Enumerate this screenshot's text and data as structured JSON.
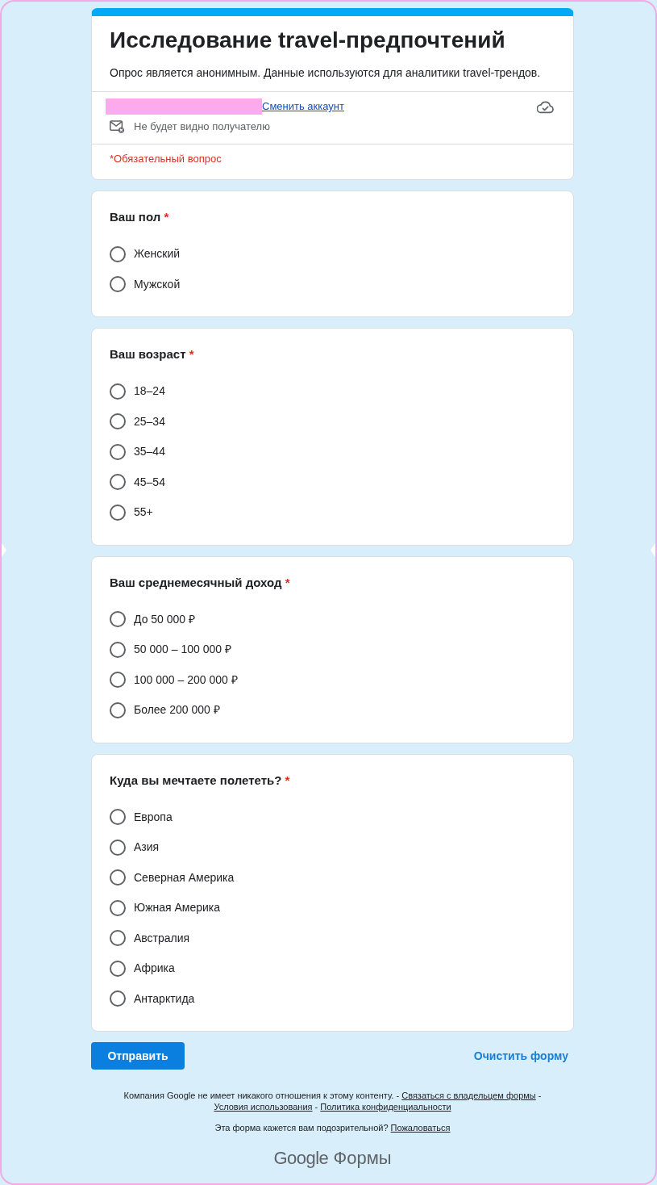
{
  "header": {
    "title": "Исследование travel-предпочтений",
    "description": "Опрос является анонимным. Данные используются для аналитики travel-трендов.",
    "switch_account": "Сменить аккаунт",
    "privacy_note": "Не будет видно получателю",
    "required_note": "*Обязательный вопрос"
  },
  "questions": [
    {
      "title": "Ваш пол",
      "required_mark": "*",
      "options": [
        {
          "label": "Женский",
          "selected": false
        },
        {
          "label": "Мужской",
          "selected": false
        }
      ]
    },
    {
      "title": "Ваш возраст",
      "required_mark": "*",
      "options": [
        {
          "label": "18–24",
          "selected": false
        },
        {
          "label": "25–34",
          "selected": false
        },
        {
          "label": "35–44",
          "selected": false
        },
        {
          "label": "45–54",
          "selected": false
        },
        {
          "label": "55+",
          "selected": false
        }
      ]
    },
    {
      "title": "Ваш среднемесячный доход",
      "required_mark": "*",
      "options": [
        {
          "label": "До 50 000 ₽",
          "selected": false
        },
        {
          "label": "50 000 – 100 000 ₽",
          "selected": false
        },
        {
          "label": "100 000 – 200 000 ₽",
          "selected": false
        },
        {
          "label": "Более 200 000 ₽",
          "selected": false
        }
      ]
    },
    {
      "title": "Куда вы мечтаете полететь?",
      "required_mark": "*",
      "options": [
        {
          "label": "Европа",
          "selected": false
        },
        {
          "label": "Азия",
          "selected": false
        },
        {
          "label": "Северная Америка",
          "selected": false
        },
        {
          "label": "Южная Америка",
          "selected": false
        },
        {
          "label": "Австралия",
          "selected": false
        },
        {
          "label": "Африка",
          "selected": false
        },
        {
          "label": "Антарктида",
          "selected": false
        }
      ]
    }
  ],
  "actions": {
    "submit": "Отправить",
    "clear": "Очистить форму"
  },
  "footer": {
    "notice": [
      {
        "kind": "text",
        "text": "Компания Google не имеет никакого отношения к этому контенту. -"
      },
      {
        "kind": "link",
        "text": "Связаться с владельцем формы"
      },
      {
        "kind": "text",
        "text": "-"
      },
      {
        "kind": "link",
        "text": "Условия использования"
      },
      {
        "kind": "text",
        "text": "-"
      },
      {
        "kind": "link",
        "text": "Политика конфиденциальности"
      }
    ],
    "report": [
      {
        "kind": "text",
        "text": "Эта форма кажется вам подозрительной?"
      },
      {
        "kind": "link",
        "text": "Пожаловаться"
      }
    ],
    "logo": {
      "brand": "Google",
      "product": "Формы"
    }
  }
}
